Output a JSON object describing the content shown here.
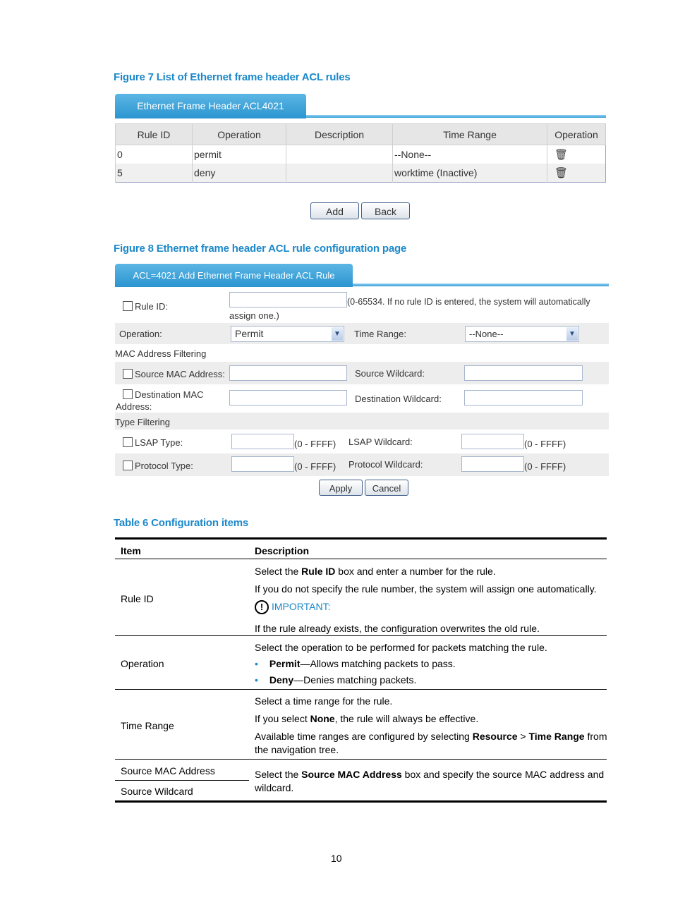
{
  "figure7": {
    "caption": "Figure 7 List of Ethernet frame header ACL rules",
    "tab": "Ethernet Frame Header ACL4021",
    "columns": [
      "Rule ID",
      "Operation",
      "Description",
      "Time Range",
      "Operation"
    ],
    "rows": [
      {
        "rule_id": "0",
        "operation": "permit",
        "description": "",
        "time_range": "--None--",
        "action_icon": "trash-icon"
      },
      {
        "rule_id": "5",
        "operation": "deny",
        "description": "",
        "time_range": "worktime (Inactive)",
        "action_icon": "trash-icon"
      }
    ],
    "add_label": "Add",
    "back_label": "Back"
  },
  "figure8": {
    "caption": "Figure 8 Ethernet frame header ACL rule configuration page",
    "tab": "ACL=4021 Add Ethernet Frame Header ACL Rule",
    "rule_id_label": "Rule ID:",
    "rule_id_value": "",
    "rule_id_hint1": "(0-65534. If no rule ID is entered, the system will automatically",
    "rule_id_hint2": "assign one.)",
    "operation_label": "Operation:",
    "operation_value": "Permit",
    "time_range_label": "Time Range:",
    "time_range_value": "--None--",
    "mac_section": "MAC Address Filtering",
    "src_mac_label": "Source MAC Address:",
    "src_wild_label": "Source Wildcard:",
    "dst_mac_label1": "Destination MAC",
    "dst_mac_label2": "Address:",
    "dst_wild_label": "Destination Wildcard:",
    "type_section": "Type Filtering",
    "lsap_label": "LSAP Type:",
    "lsap_range": "(0 - FFFF)",
    "lsap_wild_label": "LSAP Wildcard:",
    "lsap_wild_range": "(0 - FFFF)",
    "proto_label": "Protocol Type:",
    "proto_range": "(0 - FFFF)",
    "proto_wild_label": "Protocol Wildcard:",
    "proto_wild_range": "(0 - FFFF)",
    "apply_label": "Apply",
    "cancel_label": "Cancel"
  },
  "table6": {
    "caption": "Table 6 Configuration items",
    "head_item": "Item",
    "head_desc": "Description",
    "rule_id": {
      "item": "Rule ID",
      "l1a": "Select the ",
      "l1b": "Rule ID",
      "l1c": " box and enter a number for the rule.",
      "l2": "If you do not specify the rule number, the system will assign one automatically.",
      "important": "IMPORTANT:",
      "l3": "If the rule already exists, the configuration overwrites the old rule."
    },
    "operation": {
      "item": "Operation",
      "l1": "Select the operation to be performed for packets matching the rule.",
      "b1a": "Permit",
      "b1b": "—Allows matching packets to pass.",
      "b2a": "Deny",
      "b2b": "—Denies matching packets."
    },
    "time_range": {
      "item": "Time Range",
      "l1": "Select a time range for the rule.",
      "l2a": "If you select ",
      "l2b": "None",
      "l2c": ", the rule will always be effective.",
      "l3a": "Available time ranges are configured by selecting ",
      "l3b": "Resource",
      "l3c": " > ",
      "l3d": "Time Range",
      "l3e": " from",
      "l4": "the navigation tree."
    },
    "source": {
      "item1": "Source MAC Address",
      "item2": "Source Wildcard",
      "l1a": "Select the ",
      "l1b": "Source MAC Address",
      "l1c": " box and specify the source MAC address and",
      "l2": "wildcard."
    }
  },
  "page_number": "10",
  "colors": {
    "caption": "#1c88c9",
    "tab": "#2b95d0"
  }
}
